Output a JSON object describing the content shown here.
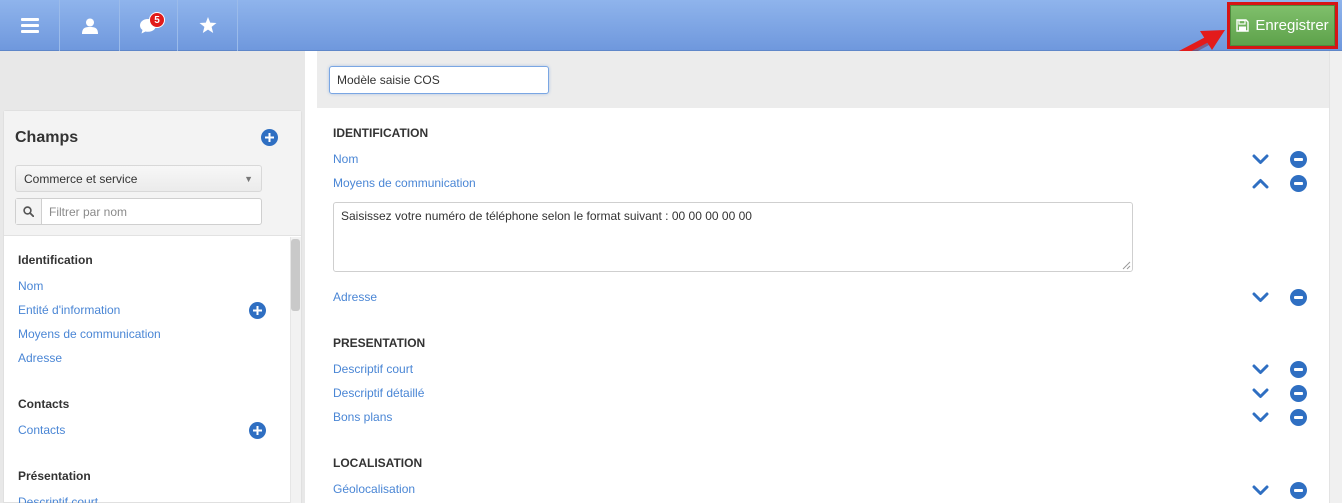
{
  "topbar": {
    "nav": [
      {
        "name": "menu",
        "icon": "hamburger-menu-icon"
      },
      {
        "name": "user",
        "icon": "user-icon"
      },
      {
        "name": "messages",
        "icon": "chat-bubble-icon",
        "badge": "5"
      },
      {
        "name": "favorites",
        "icon": "star-icon"
      }
    ],
    "save_label": "Enregistrer",
    "save_icon": "floppy-disk-icon"
  },
  "sidebar": {
    "title": "Champs",
    "category_select": "Commerce et service",
    "filter_placeholder": "Filtrer par nom",
    "sections": [
      {
        "title": "Identification",
        "items": [
          "Nom",
          "Entité d'information",
          "Moyens de communication",
          "Adresse"
        ]
      },
      {
        "title": "Contacts",
        "items": [
          "Contacts"
        ]
      },
      {
        "title": "Présentation",
        "items": [
          "Descriptif court"
        ]
      }
    ]
  },
  "main": {
    "model_name": "Modèle saisie COS",
    "sections": [
      {
        "title": "IDENTIFICATION",
        "fields": [
          "Nom",
          "Moyens de communication",
          "Adresse"
        ]
      },
      {
        "title": "PRESENTATION",
        "fields": [
          "Descriptif court",
          "Descriptif détaillé",
          "Bons plans"
        ]
      },
      {
        "title": "LOCALISATION",
        "fields": [
          "Géolocalisation"
        ]
      }
    ],
    "help_text": "Saisissez votre numéro de téléphone selon le format suivant : 00 00 00 00 00"
  },
  "colors": {
    "topbar": "#7aa3e5",
    "save_button": "#6bb257",
    "highlight": "#d61515",
    "link": "#4a86d5",
    "icon_blue": "#2f6fc2"
  }
}
